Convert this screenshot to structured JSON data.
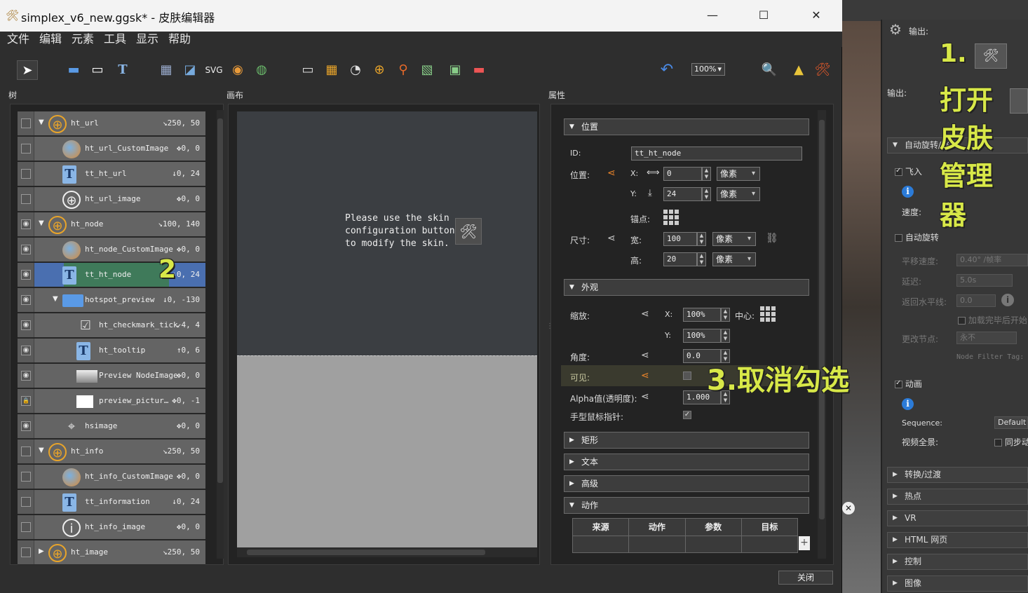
{
  "window": {
    "title": "simplex_v6_new.ggsk* - 皮肤编辑器"
  },
  "menu": [
    "文件",
    "编辑",
    "元素",
    "工具",
    "显示",
    "帮助"
  ],
  "toolbar": {
    "zoom": "100%"
  },
  "panels": {
    "tree": "树",
    "canvas": "画布",
    "properties": "属性"
  },
  "tree_rows": [
    {
      "name": "ht_url",
      "pos": "↘250, 50",
      "icon": "crosshair-icon",
      "visible": false,
      "indent": 0,
      "arrow": "▼"
    },
    {
      "name": "ht_url_CustomImage",
      "pos": "✥0, 0",
      "icon": "globe-image-icon",
      "visible": false,
      "indent": 1,
      "arrow": ""
    },
    {
      "name": "tt_ht_url",
      "pos": "↓0, 24",
      "icon": "text-T-icon",
      "visible": false,
      "indent": 1,
      "arrow": ""
    },
    {
      "name": "ht_url_image",
      "pos": "✥0, 0",
      "icon": "web-globe-icon",
      "visible": false,
      "indent": 1,
      "arrow": ""
    },
    {
      "name": "ht_node",
      "pos": "↘100, 140",
      "icon": "crosshair-icon",
      "visible": true,
      "indent": 0,
      "arrow": "▼"
    },
    {
      "name": "ht_node_CustomImage",
      "pos": "✥0, 0",
      "icon": "globe-image-icon",
      "visible": true,
      "indent": 1,
      "arrow": ""
    },
    {
      "name": "tt_ht_node",
      "pos": "↓0, 24",
      "icon": "text-T-icon",
      "visible": true,
      "indent": 1,
      "arrow": "",
      "selected": true
    },
    {
      "name": "hotspot_preview",
      "pos": "↓0, -130",
      "icon": "folder-icon",
      "visible": true,
      "indent": 1,
      "arrow": "▼"
    },
    {
      "name": "ht_checkmark_tick",
      "pos": "↙4, 4",
      "icon": "checkbox-icon",
      "visible": true,
      "indent": 2,
      "arrow": ""
    },
    {
      "name": "ht_tooltip",
      "pos": "↑0, 6",
      "icon": "text-T-icon",
      "visible": true,
      "indent": 2,
      "arrow": ""
    },
    {
      "name": "Preview NodeImage",
      "pos": "✥0, 0",
      "icon": "preview-image-icon",
      "visible": true,
      "indent": 2,
      "arrow": ""
    },
    {
      "name": "preview_pictur…",
      "pos": "✥0, -1",
      "icon": "white-rect-icon",
      "visible": "lock",
      "indent": 2,
      "arrow": ""
    },
    {
      "name": "hsimage",
      "pos": "✥0, 0",
      "icon": "target-icon",
      "visible": true,
      "indent": 1,
      "arrow": ""
    },
    {
      "name": "ht_info",
      "pos": "↘250, 50",
      "icon": "crosshair-icon",
      "visible": false,
      "indent": 0,
      "arrow": "▼"
    },
    {
      "name": "ht_info_CustomImage",
      "pos": "✥0, 0",
      "icon": "globe-image-icon",
      "visible": false,
      "indent": 1,
      "arrow": ""
    },
    {
      "name": "tt_information",
      "pos": "↓0, 24",
      "icon": "text-T-icon",
      "visible": false,
      "indent": 1,
      "arrow": ""
    },
    {
      "name": "ht_info_image",
      "pos": "✥0, 0",
      "icon": "info-circle-icon",
      "visible": false,
      "indent": 1,
      "arrow": ""
    },
    {
      "name": "ht_image",
      "pos": "↘250, 50",
      "icon": "crosshair-icon",
      "visible": false,
      "indent": 0,
      "arrow": "▶"
    }
  ],
  "canvas": {
    "message": "Please use the skin\nconfiguration button\nto modify the skin."
  },
  "props": {
    "sec_position": "位置",
    "id_label": "ID:",
    "id_value": "tt_ht_node",
    "pos_label": "位置:",
    "x_label": "X:",
    "x_value": "0",
    "y_label": "Y:",
    "y_value": "24",
    "unit": "像素",
    "anchor_label": "锚点:",
    "size_label": "尺寸:",
    "w_label": "宽:",
    "w_value": "100",
    "h_label": "高:",
    "h_value": "20",
    "sec_appearance": "外观",
    "scale_label": "缩放:",
    "sx_value": "100%",
    "sy_value": "100%",
    "center_label": "中心:",
    "angle_label": "角度:",
    "angle_value": "0.0",
    "visible_label": "可见:",
    "alpha_label": "Alpha值(透明度):",
    "alpha_value": "1.000",
    "cursor_label": "手型鼠标指针:",
    "sec_rect": "矩形",
    "sec_text": "文本",
    "sec_advanced": "高级",
    "sec_action": "动作",
    "table_headers": [
      "来源",
      "动作",
      "参数",
      "目标"
    ]
  },
  "close_button": "关闭",
  "bg_app": {
    "output1": "输出:",
    "output2": "输出:",
    "sec_autorotate": "自动旋转/飞",
    "fly_in": "飞入",
    "speed": "速度:",
    "autorotate": "自动旋转",
    "pan_speed": "平移速度:",
    "pan_speed_value": "0.40° /帧率",
    "delay": "延迟:",
    "delay_value": "5.0s",
    "return_horizon": "返回水平线:",
    "return_value": "0.0",
    "start_after_load": "加载完毕后开始",
    "change_node": "更改节点:",
    "change_node_value": "永不",
    "node_filter": "Node Filter Tag:",
    "animation": "动画",
    "sequence": "Sequence:",
    "sequence_value": "Default",
    "video_pano": "视频全景:",
    "sync": "同步动",
    "sections": [
      "转换/过渡",
      "热点",
      "VR",
      "HTML 网页",
      "控制",
      "图像"
    ]
  },
  "annotations": {
    "step1": "1.",
    "step1_text": [
      "打开",
      "皮肤",
      "管理",
      "器"
    ],
    "step2": "2",
    "step3": "3.取消勾选"
  },
  "colors": {
    "accent_annot": "#d8e848",
    "share_orange": "#e8832a",
    "selection_blue": "#4a6fb0"
  }
}
